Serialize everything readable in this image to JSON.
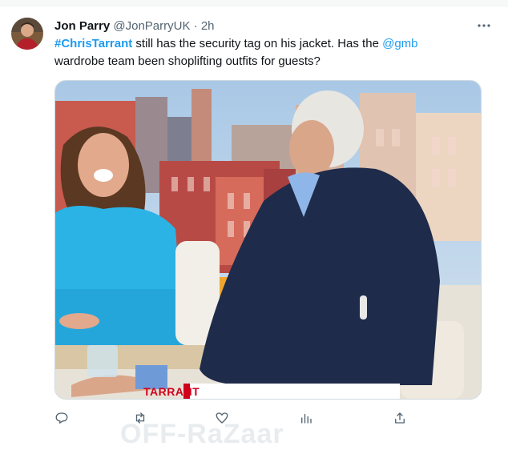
{
  "tweet": {
    "author_name": "Jon Parry",
    "author_handle": "@JonParryUK",
    "separator": "·",
    "time": "2h",
    "body": {
      "hashtag": "#ChrisTarrant",
      "text1": " still has the security tag on his jacket. Has the ",
      "mention": "@gmb",
      "text2": " wardrobe team been shoplifting outfits for guests?"
    },
    "media": {
      "lower_third_text": "TARRANT"
    },
    "actions": {
      "reply_icon": "reply-icon",
      "retweet_icon": "retweet-icon",
      "like_icon": "like-icon",
      "like_count": "",
      "views_icon": "views-icon",
      "views_count": "",
      "share_icon": "share-icon"
    },
    "watermark_text": "OFF-RaZaar"
  },
  "colors": {
    "link": "#1d9bf0",
    "text": "#0f1419",
    "muted": "#536471"
  }
}
